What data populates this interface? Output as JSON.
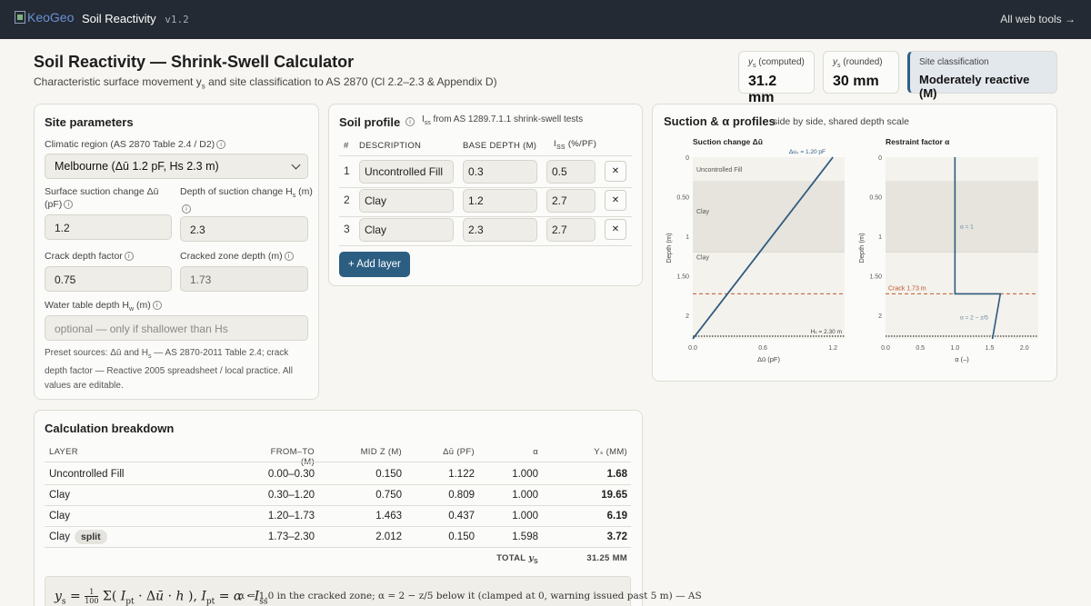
{
  "topbar": {
    "logo_alt": "KeoGeo",
    "app_name": "Soil Reactivity",
    "version": "v1.2",
    "all_tools": "All web tools →"
  },
  "header": {
    "title": "Soil Reactivity — Shrink-Swell Calculator",
    "subtitle_pre": "Characteristic surface movement y",
    "subtitle_sub": "s",
    "subtitle_post": " and site classification to AS 2870 (Cl 2.2–2.3 & Appendix D)"
  },
  "summary": {
    "computed_label": "(computed)",
    "computed_value": "31.2 mm",
    "rounded_label": "(rounded)",
    "rounded_value": "30 mm",
    "classification_label": "Site classification",
    "classification_value": "Moderately reactive (M)"
  },
  "site": {
    "title": "Site parameters",
    "climatic_label": "Climatic region (AS 2870 Table 2.4 / D2)",
    "climatic_value": "Melbourne (Δū 1.2 pF, Hs 2.3 m)",
    "suction_label_a": "Surface suction change Δū",
    "suction_label_b": "(pF)",
    "suction_value": "1.2",
    "depth_label": "Depth of suction change H",
    "depth_label_unit": " (m)",
    "depth_value": "2.3",
    "crack_label": "Crack depth factor",
    "crack_value": "0.75",
    "cracked_label": "Cracked zone depth (m)",
    "cracked_value": "1.73",
    "water_label": "Water table depth H",
    "water_label_unit": " (m)",
    "water_placeholder": "optional — only if shallower than Hs",
    "note_1": "Preset sources: Δū and H",
    "note_1b": " — AS 2870-2011 Table 2.4; crack",
    "note_2": "depth factor — Reactive 2005 spreadsheet / local practice. All",
    "note_3": "values are editable."
  },
  "profile": {
    "title": "Soil profile",
    "subtitle": " from AS 1289.7.1.1 shrink-swell tests",
    "col_num": "#",
    "col_desc": "DESCRIPTION",
    "col_base": "BASE DEPTH (M)",
    "col_iss": " (%/PF)",
    "rows": [
      {
        "n": "1",
        "desc": "Uncontrolled Fill",
        "base": "0.3",
        "iss": "0.5"
      },
      {
        "n": "2",
        "desc": "Clay",
        "base": "1.2",
        "iss": "2.7"
      },
      {
        "n": "3",
        "desc": "Clay",
        "base": "2.3",
        "iss": "2.7"
      }
    ],
    "remove_label": "✕",
    "add_label": "+ Add layer"
  },
  "profiles_chart": {
    "title": "Suction & α profiles",
    "subtitle": "side by side, shared depth scale",
    "suction_title": "Suction change Δū",
    "alpha_title": "Restraint factor α",
    "depth_axis": "Depth (m)",
    "suction_xlabel": "Δū (pF)",
    "alpha_xlabel": "α (–)",
    "delta_annot": "Δu₀ = 1.20 pF",
    "hs_annot": "Hₛ = 2.30 m",
    "crack_annot": "Crack 1.73 m",
    "alpha1_annot": "α = 1",
    "alpha2_annot": "α = 2 − z/5",
    "layer_labels": [
      "Uncontrolled Fill",
      "Clay",
      "Clay"
    ],
    "depth_ticks": [
      "0",
      "0.50",
      "1",
      "1.50",
      "2"
    ],
    "suction_ticks": [
      "0.0",
      "0.6",
      "1.2"
    ],
    "alpha_ticks": [
      "0.0",
      "0.5",
      "1.0",
      "1.5",
      "2.0"
    ]
  },
  "chart_data": [
    {
      "type": "line",
      "title": "Suction change Δū",
      "xlabel": "Δū (pF)",
      "ylabel": "Depth (m)",
      "xlim": [
        0,
        1.3
      ],
      "ylim": [
        2.3,
        0
      ],
      "x": [
        1.2,
        0
      ],
      "y": [
        0,
        2.3
      ]
    },
    {
      "type": "line",
      "title": "Restraint factor α",
      "xlabel": "α (–)",
      "ylabel": "Depth (m)",
      "xlim": [
        0,
        2.2
      ],
      "ylim": [
        2.3,
        0
      ],
      "x": [
        1.0,
        1.0,
        1.654,
        1.54
      ],
      "y": [
        0,
        1.73,
        1.73,
        2.3
      ]
    }
  ],
  "breakdown": {
    "title": "Calculation breakdown",
    "headers": [
      "LAYER",
      "FROM–TO (M)",
      "MID Z (M)",
      "Δū (PF)",
      "α",
      "Yₛ (MM)"
    ],
    "rows": [
      {
        "layer": "Uncontrolled Fill",
        "split": "",
        "fromto": "0.00–0.30",
        "mid": "0.150",
        "du": "1.122",
        "alpha": "1.000",
        "ys": "1.68"
      },
      {
        "layer": "Clay",
        "split": "",
        "fromto": "0.30–1.20",
        "mid": "0.750",
        "du": "0.809",
        "alpha": "1.000",
        "ys": "19.65"
      },
      {
        "layer": "Clay",
        "split": "",
        "fromto": "1.20–1.73",
        "mid": "1.463",
        "du": "0.437",
        "alpha": "1.000",
        "ys": "6.19"
      },
      {
        "layer": "Clay",
        "split": "split",
        "fromto": "1.73–2.30",
        "mid": "2.012",
        "du": "0.150",
        "alpha": "1.598",
        "ys": "3.72"
      }
    ],
    "total_label": "TOTAL",
    "total_value": "31.25 MM",
    "formula_note": "α = 1.0 in the cracked zone; α = 2 − z/5 below it (clamped at 0, warning issued past 5 m) — AS"
  }
}
